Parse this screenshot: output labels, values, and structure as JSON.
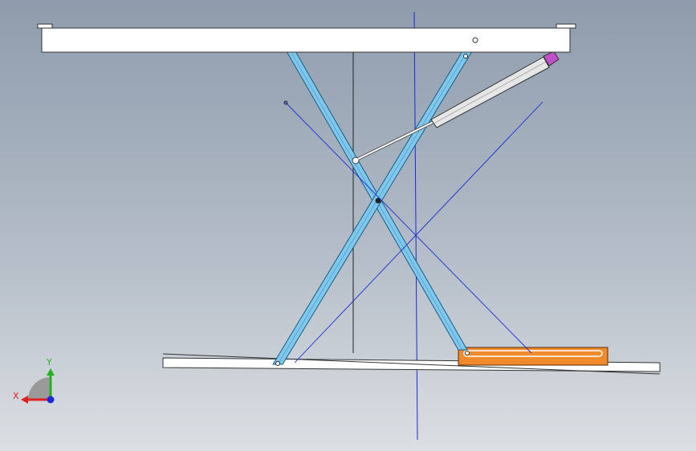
{
  "viewport": {
    "background_top": "#8e9cad",
    "background_bottom": "#dcdfe3"
  },
  "parts": [
    {
      "name": "top-platform",
      "color": "#ffffff"
    },
    {
      "name": "base-plate",
      "color": "#ffffff"
    },
    {
      "name": "scissor-arm-a",
      "color": "#7ec8ee"
    },
    {
      "name": "scissor-arm-b",
      "color": "#7ec8ee"
    },
    {
      "name": "slide-block",
      "color": "#f08a2c"
    },
    {
      "name": "hydraulic-cylinder",
      "color": "#e6e6e6"
    },
    {
      "name": "cylinder-end-fitting",
      "color": "#c34fc8"
    }
  ],
  "reference_line_color": "#1a2ad6",
  "triad": {
    "x_label": "X",
    "y_label": "Y",
    "x_color": "#e02020",
    "y_color": "#20b020",
    "z_color": "#1a2ad6"
  }
}
